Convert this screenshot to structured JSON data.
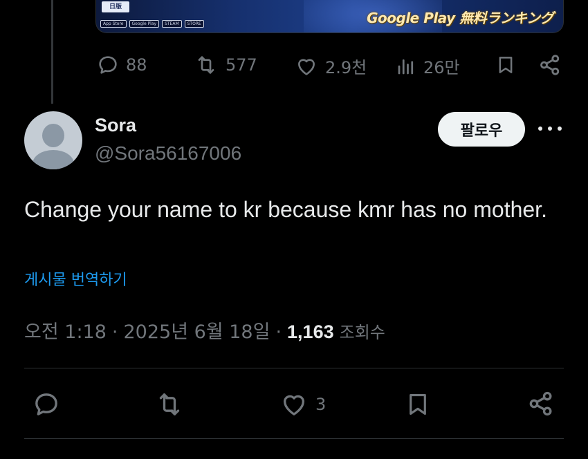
{
  "parent_tweet": {
    "banner": {
      "logo_text": "日版",
      "store_badges": [
        "App Store",
        "Google Play",
        "STEAM",
        "STORE"
      ],
      "ranking_text": "Google Play 無料ランキング"
    },
    "actions": {
      "replies": "88",
      "reposts": "577",
      "likes": "2.9천",
      "views": "26만"
    }
  },
  "tweet": {
    "author": {
      "display_name": "Sora",
      "handle": "@Sora56167006"
    },
    "follow_label": "팔로우",
    "text": "Change your name to kr because kmr has no mother.",
    "translate_label": "게시물 번역하기",
    "time": "오전 1:18",
    "date": "2025년 6월 18일",
    "separator": "·",
    "views_count": "1,163",
    "views_label": "조회수",
    "actions": {
      "likes": "3"
    }
  },
  "colors": {
    "background": "#000000",
    "text_primary": "#e7e9ea",
    "text_secondary": "#71767b",
    "link": "#1d9bf0",
    "divider": "#2f3336"
  },
  "icons": [
    "reply-icon",
    "repost-icon",
    "like-icon",
    "views-icon",
    "bookmark-icon",
    "share-icon",
    "more-icon"
  ]
}
